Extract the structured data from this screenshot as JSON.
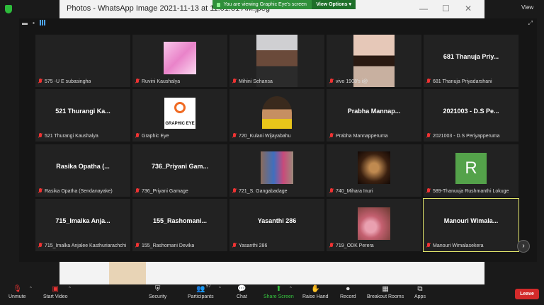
{
  "photos_window": {
    "title": "Photos - WhatsApp Image 2021-11-13 at 11.01.31 AM.jpeg",
    "minimize": "—",
    "maximize": "☐",
    "close": "✕"
  },
  "share_banner": {
    "text": "You are viewing Graphic Eye's screen",
    "view_options": "View Options ▾"
  },
  "view_button": "View",
  "gallery": {
    "tools": [
      "▬",
      "▪"
    ],
    "exit_icon": "⤢"
  },
  "participants": [
    {
      "display": "",
      "label": "575 -U E subasingha"
    },
    {
      "display": "",
      "label": "Ruvini Kaushalya"
    },
    {
      "display": "",
      "label": "Mihini Sehansa"
    },
    {
      "display": "",
      "label": "vivo 1908's i@"
    },
    {
      "display": "681 Thanuja Priy...",
      "label": "681 Thanuja Priyadarshani"
    },
    {
      "display": "521 Thurangi Ka...",
      "label": "521 Thurangi Kaushalya"
    },
    {
      "display": "GRAPHIC EYE",
      "label": "Graphic Eye"
    },
    {
      "display": "",
      "label": "720_Kulani Wijayabahu"
    },
    {
      "display": "Prabha Mannap...",
      "label": "Prabha Mannapperuma"
    },
    {
      "display": "2021003 - D.S Pe...",
      "label": "2021003 - D.S Periyapperuma"
    },
    {
      "display": "Rasika Opatha (...",
      "label": "Rasika Opatha (Sendanayake)"
    },
    {
      "display": "736_Priyani Gam...",
      "label": "736_Priyani Gamage"
    },
    {
      "display": "",
      "label": "721_S. Gangabadage"
    },
    {
      "display": "",
      "label": "740_Mihara Inuri"
    },
    {
      "display": "R",
      "label": "589-Thanuuja Rushmanthi Lokuge"
    },
    {
      "display": "715_Imalka Anja...",
      "label": "715_Imalka Anjalee Kasthuriarachchi"
    },
    {
      "display": "155_Rashomani...",
      "label": "155_Rashomani Devika"
    },
    {
      "display": "Yasanthi 286",
      "label": "Yasanthi 286"
    },
    {
      "display": "",
      "label": "719_ODK Perera"
    },
    {
      "display": "Manouri Wimala...",
      "label": "Manouri Wimalasekera"
    }
  ],
  "toolbar": {
    "unmute": "Unmute",
    "start_video": "Start Video",
    "security": "Security",
    "participants": "Participants",
    "participant_count": "57",
    "chat": "Chat",
    "share_screen": "Share Screen",
    "raise_hand": "Raise Hand",
    "record": "Record",
    "breakout_rooms": "Breakout Rooms",
    "apps": "Apps",
    "leave": "Leave"
  }
}
